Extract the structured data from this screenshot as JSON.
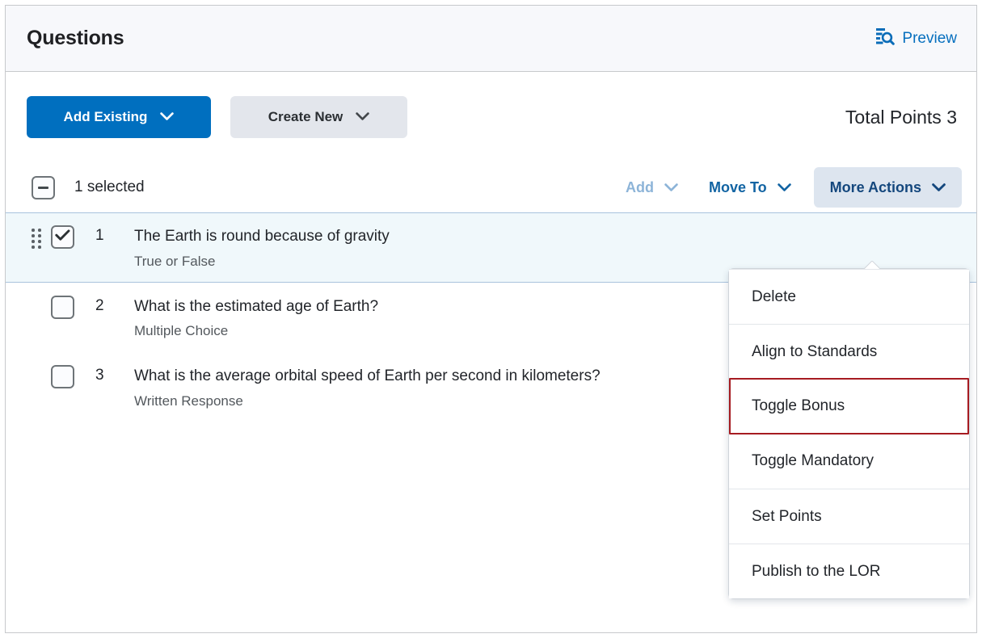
{
  "header": {
    "title": "Questions",
    "preview_label": "Preview",
    "preview_icon": "document-search-icon"
  },
  "toolbar": {
    "add_existing_label": "Add Existing",
    "create_new_label": "Create New",
    "total_points_label": "Total Points 3",
    "chevron_icon": "chevron-down-icon"
  },
  "selection_bar": {
    "checkbox_state": "indeterminate",
    "selected_text": "1 selected",
    "actions": [
      {
        "label": "Add",
        "state": "disabled"
      },
      {
        "label": "Move To",
        "state": "normal"
      },
      {
        "label": "More Actions",
        "state": "active"
      }
    ]
  },
  "questions": [
    {
      "number": "1",
      "title": "The Earth is round because of gravity",
      "type": "True or False",
      "checked": true,
      "selected": true
    },
    {
      "number": "2",
      "title": "What is the estimated age of Earth?",
      "type": "Multiple Choice",
      "checked": false,
      "selected": false
    },
    {
      "number": "3",
      "title": "What is the average orbital speed of Earth per second in kilometers?",
      "type": "Written Response",
      "checked": false,
      "selected": false
    }
  ],
  "more_actions_menu": {
    "open": true,
    "items": [
      {
        "label": "Delete",
        "highlighted": false
      },
      {
        "label": "Align to Standards",
        "highlighted": false
      },
      {
        "label": "Toggle Bonus",
        "highlighted": true
      },
      {
        "label": "Toggle Mandatory",
        "highlighted": false
      },
      {
        "label": "Set Points",
        "highlighted": false
      },
      {
        "label": "Publish to the LOR",
        "highlighted": false
      }
    ]
  },
  "colors": {
    "primary_blue": "#006fbf",
    "link_blue": "#066fbe",
    "disabled_blue": "#8db4d8",
    "active_bg": "#dde5ef",
    "selected_row_bg": "#f0f8fb",
    "highlight_red": "#a61b21",
    "header_bg": "#f7f8fb"
  }
}
